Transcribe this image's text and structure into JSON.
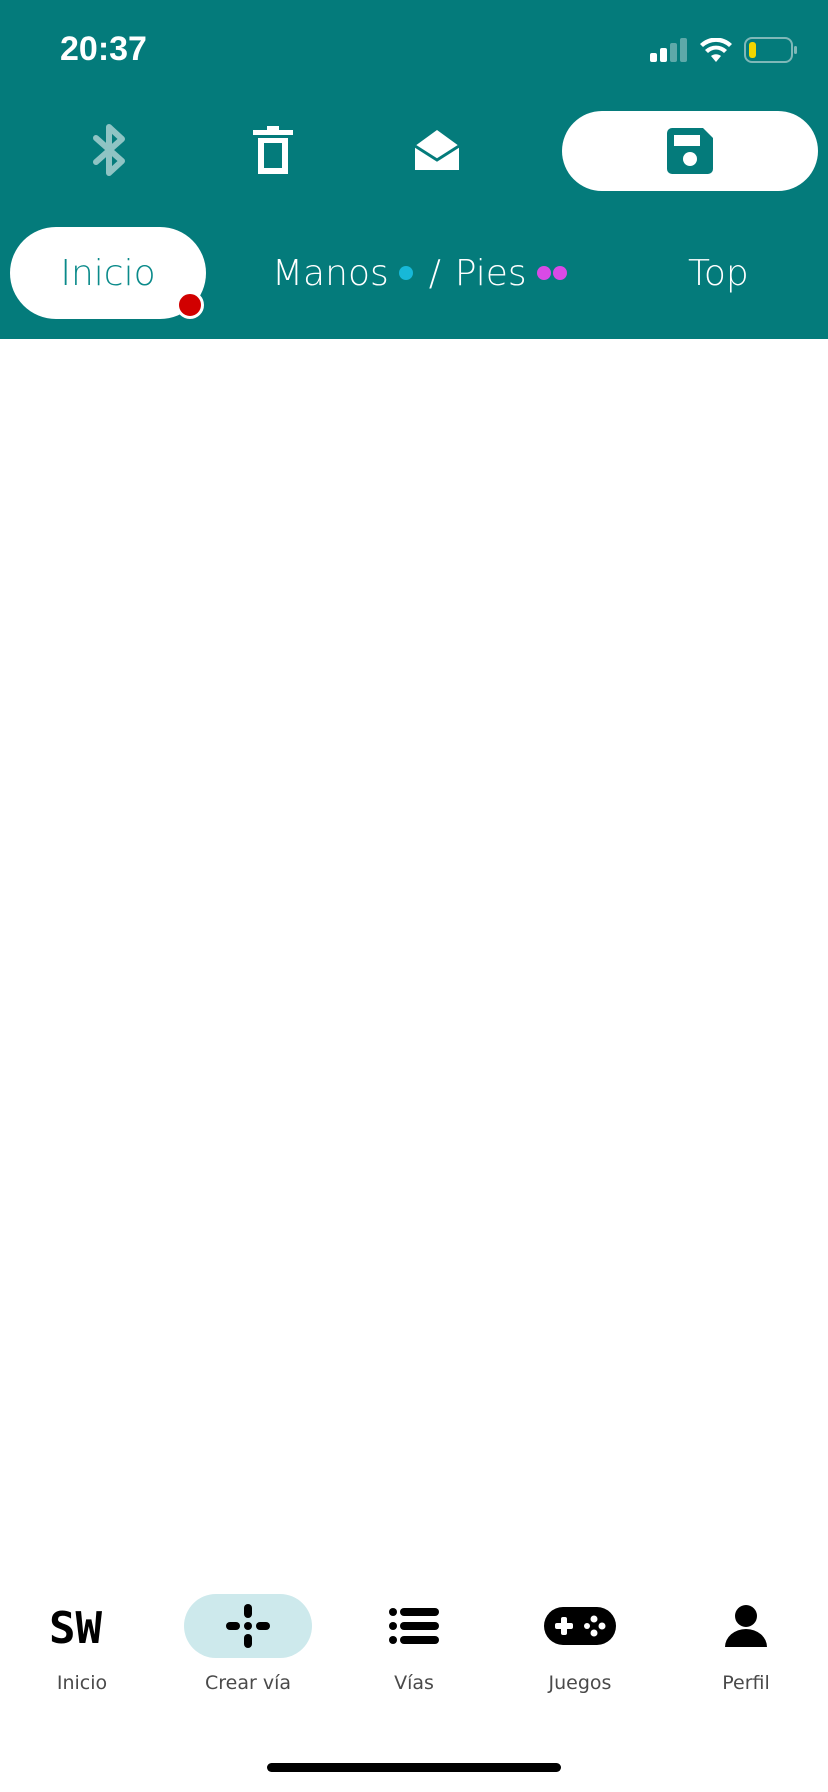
{
  "status_bar": {
    "time": "20:37",
    "icons": [
      "cellular-signal-icon",
      "wifi-icon",
      "battery-low-icon"
    ]
  },
  "toolbar": {
    "buttons": [
      {
        "name": "bluetooth-icon",
        "enabled": false
      },
      {
        "name": "trash-icon",
        "enabled": true
      },
      {
        "name": "envelope-open-icon",
        "enabled": true
      },
      {
        "name": "floppy-save-icon",
        "enabled": true
      }
    ]
  },
  "tabs": {
    "inicio": "Inicio",
    "manos": "Manos",
    "separator": "/",
    "pies": "Pies",
    "top": "Top"
  },
  "bottom_nav": {
    "items": [
      {
        "label": "Inicio",
        "icon": "sw-logo-icon"
      },
      {
        "label": "Crear vía",
        "icon": "crosshair-plus-icon",
        "active": true
      },
      {
        "label": "Vías",
        "icon": "list-icon"
      },
      {
        "label": "Juegos",
        "icon": "gamepad-icon"
      },
      {
        "label": "Perfil",
        "icon": "user-icon"
      }
    ]
  },
  "colors": {
    "header": "#047b7b",
    "accent_teal": "#0a8a8a",
    "notification": "#d10000",
    "manos_dot": "#17b8d8",
    "pies_dot": "#d94ae6",
    "active_nav_bg": "#cde9ec",
    "battery_level": "#f2d600"
  }
}
